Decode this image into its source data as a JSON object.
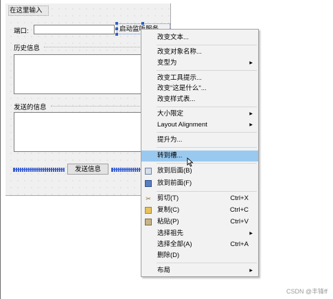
{
  "form": {
    "menubar_placeholder": "在这里输入",
    "port_label": "端口:",
    "start_button_label": "启动监听服务",
    "history_label": "历史信息",
    "send_label": "发送的信息",
    "send_button_label": "发送信息"
  },
  "context_menu": {
    "items": [
      {
        "label": "改变文本..."
      },
      {
        "label": "改变对象名称..."
      },
      {
        "label": "变型为",
        "submenu": true
      },
      {
        "label": "改变工具提示..."
      },
      {
        "label": "改变\"这是什么\"..."
      },
      {
        "label": "改变样式表..."
      },
      {
        "label": "大小限定",
        "submenu": true
      },
      {
        "label": "Layout Alignment",
        "submenu": true
      },
      {
        "label": "提升为..."
      },
      {
        "label": "转到槽...",
        "highlighted": true
      },
      {
        "label": "放到后面(B)",
        "icon": "send-to-back-icon"
      },
      {
        "label": "放到前面(F)",
        "icon": "bring-to-front-icon"
      },
      {
        "label": "剪切(T)",
        "shortcut": "Ctrl+X",
        "icon": "cut-icon"
      },
      {
        "label": "复制(C)",
        "shortcut": "Ctrl+C",
        "icon": "copy-icon"
      },
      {
        "label": "粘贴(P)",
        "shortcut": "Ctrl+V",
        "icon": "paste-icon"
      },
      {
        "label": "选择祖先",
        "submenu": true
      },
      {
        "label": "选择全部(A)",
        "shortcut": "Ctrl+A"
      },
      {
        "label": "删除(D)"
      },
      {
        "label": "布局",
        "submenu": true
      }
    ]
  },
  "watermark": "CSDN @丰锋ff",
  "colors": {
    "highlight": "#99c9ef",
    "selection_handle": "#2f5fbf",
    "spacer": "#3a5fd0"
  }
}
